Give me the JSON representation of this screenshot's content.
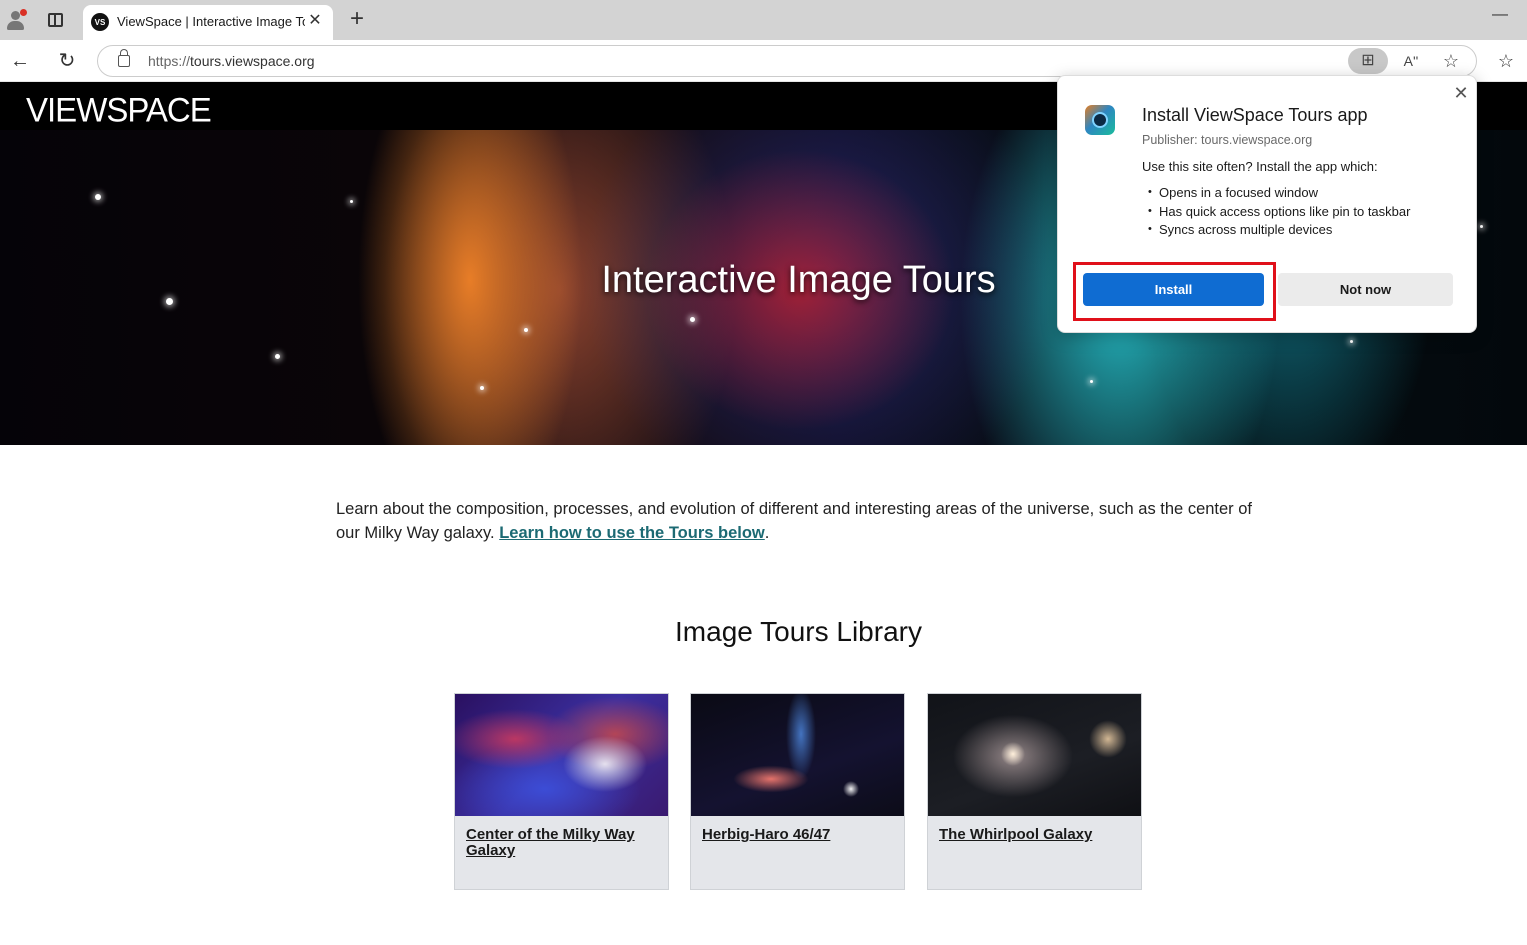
{
  "browser": {
    "tab": {
      "favicon_text": "VS",
      "title": "ViewSpace | Interactive Image Tours",
      "close": "✕"
    },
    "new_tab": "+",
    "minimize": "—",
    "back": "←",
    "reload": "↻",
    "url_scheme": "https://",
    "url_host": "tours.viewspace.org",
    "icons": {
      "app_available": "⊞",
      "read_aloud": "Aʹʹ",
      "favorite": "☆",
      "favorites_bar": "☆"
    }
  },
  "site": {
    "logo": "VIEWSPACE",
    "hero_title": "Interactive Image Tours",
    "intro_text": "Learn about the composition, processes, and evolution of different and interesting areas of the universe, such as the center of our Milky Way galaxy.",
    "intro_link": "Learn how to use the Tours below",
    "intro_end": ".",
    "library_title": "Image Tours Library",
    "cards": [
      {
        "title": "Center of the Milky Way Galaxy"
      },
      {
        "title": "Herbig-Haro 46/47"
      },
      {
        "title": "The Whirlpool Galaxy"
      }
    ]
  },
  "popup": {
    "close": "✕",
    "title": "Install ViewSpace Tours app",
    "publisher": "Publisher: tours.viewspace.org",
    "prompt": "Use this site often? Install the app which:",
    "features": [
      "Opens in a focused window",
      "Has quick access options like pin to taskbar",
      "Syncs across multiple devices"
    ],
    "install_label": "Install",
    "not_now_label": "Not now",
    "highlight_color": "#e0101a",
    "install_color": "#0f6cd2"
  }
}
